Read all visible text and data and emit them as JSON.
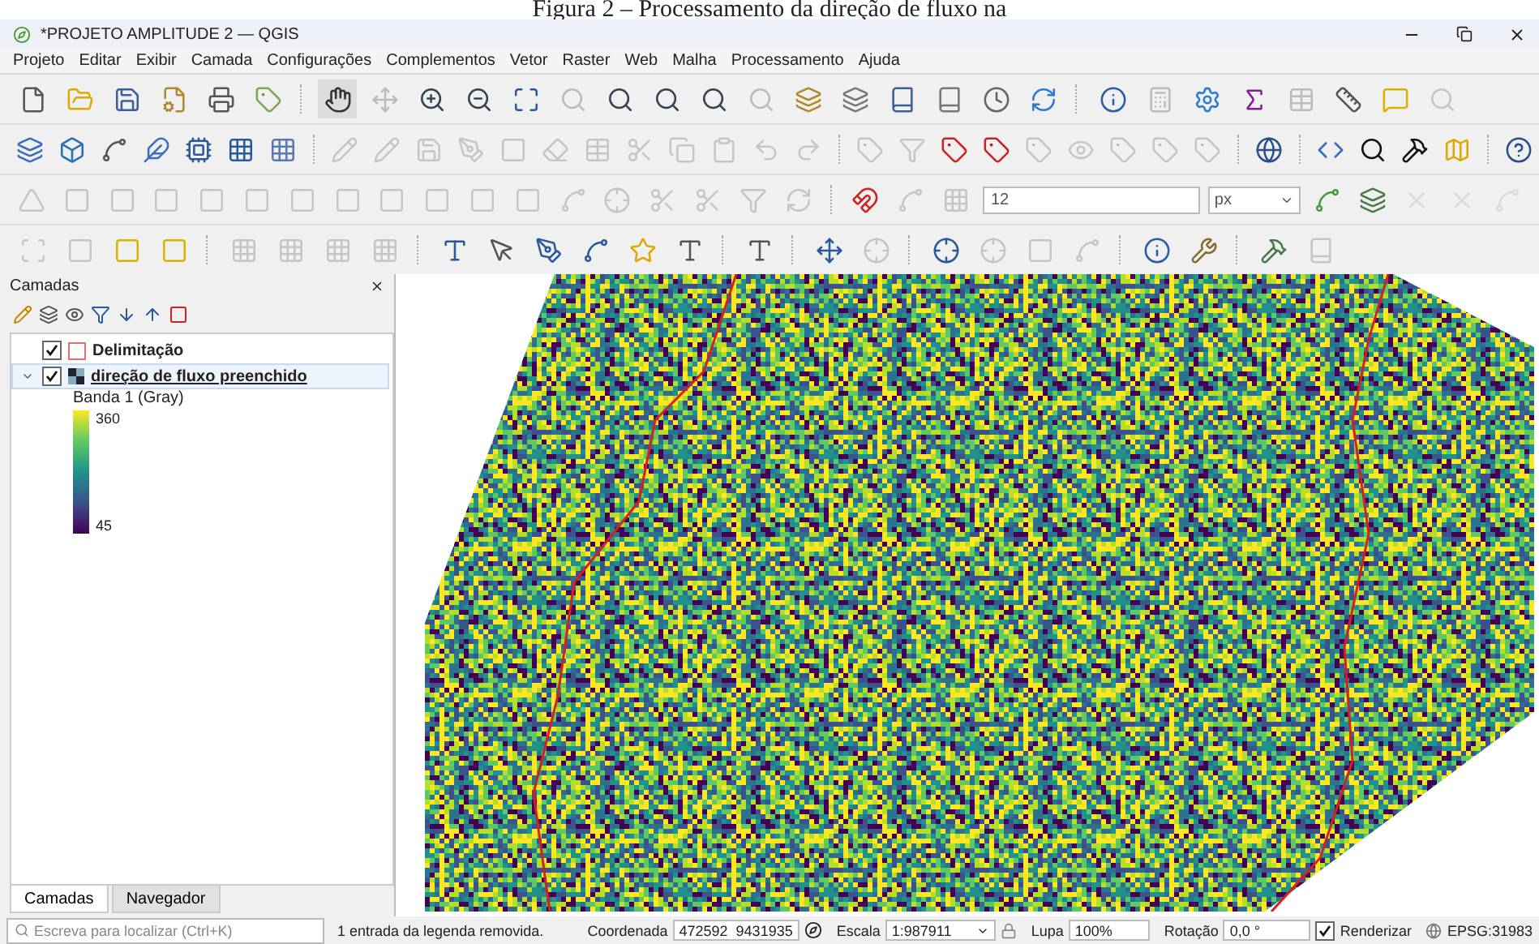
{
  "caption": "Figura 2 – Processamento da direção de fluxo na",
  "window": {
    "title": "*PROJETO AMPLITUDE 2 — QGIS"
  },
  "menu": [
    "Projeto",
    "Editar",
    "Exibir",
    "Camada",
    "Configurações",
    "Complementos",
    "Vetor",
    "Raster",
    "Web",
    "Malha",
    "Processamento",
    "Ajuda"
  ],
  "snapping": {
    "tolerance": "12",
    "unit": "px"
  },
  "layers_panel": {
    "title": "Camadas",
    "layers": [
      {
        "name": "Delimitação",
        "checked": true,
        "selected": false,
        "kind": "vector"
      },
      {
        "name": "direção de fluxo preenchido",
        "checked": true,
        "selected": true,
        "expanded": true,
        "kind": "raster",
        "legend": {
          "band": "Banda 1 (Gray)",
          "max": "360",
          "min": "45"
        }
      }
    ],
    "tabs": [
      {
        "label": "Camadas",
        "selected": true
      },
      {
        "label": "Navegador",
        "selected": false
      }
    ]
  },
  "status_bar": {
    "search_placeholder": "Escreva para localizar (Ctrl+K)",
    "message": "1 entrada da legenda removida.",
    "coordinate_label": "Coordenada",
    "coordinate": "472592  9431935",
    "scale_label": "Escala",
    "scale": "1:987911",
    "magnifier_label": "Lupa",
    "magnifier": "100%",
    "rotation_label": "Rotação",
    "rotation": "0,0 °",
    "render_label": "Renderizar",
    "render": true,
    "crs": "EPSG:31983"
  }
}
